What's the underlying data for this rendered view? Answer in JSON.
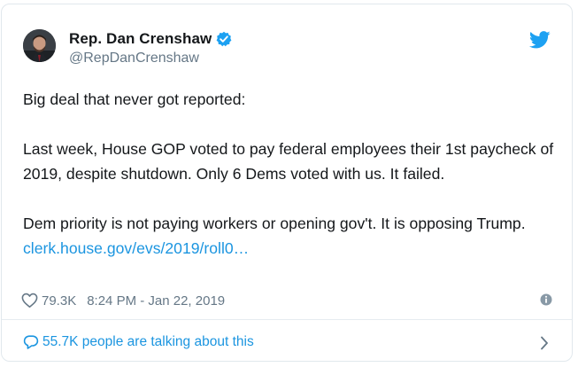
{
  "author": {
    "display_name": "Rep. Dan Crenshaw",
    "handle": "@RepDanCrenshaw"
  },
  "tweet": {
    "paragraph_1": "Big deal that never got reported:",
    "paragraph_2": "Last week, House GOP voted to pay federal employees their 1st paycheck of 2019, despite shutdown. Only 6 Dems voted with us. It failed.",
    "paragraph_3_text": "Dem priority is not paying workers or opening gov't. It is opposing Trump.",
    "link_text": "clerk.house.gov/evs/2019/roll0…"
  },
  "meta": {
    "likes": "79.3K",
    "timestamp": "8:24 PM - Jan 22, 2019"
  },
  "footer": {
    "talking_text": "55.7K people are talking about this"
  },
  "colors": {
    "link": "#1b95e0",
    "verified": "#1da1f2",
    "muted": "#657786",
    "text": "#14171a"
  },
  "icons": {
    "verified": "verified-badge-icon",
    "twitter": "twitter-bird-icon",
    "like": "heart-icon",
    "info": "info-icon",
    "conversation": "speech-bubble-icon",
    "more": "chevron-right-icon"
  }
}
